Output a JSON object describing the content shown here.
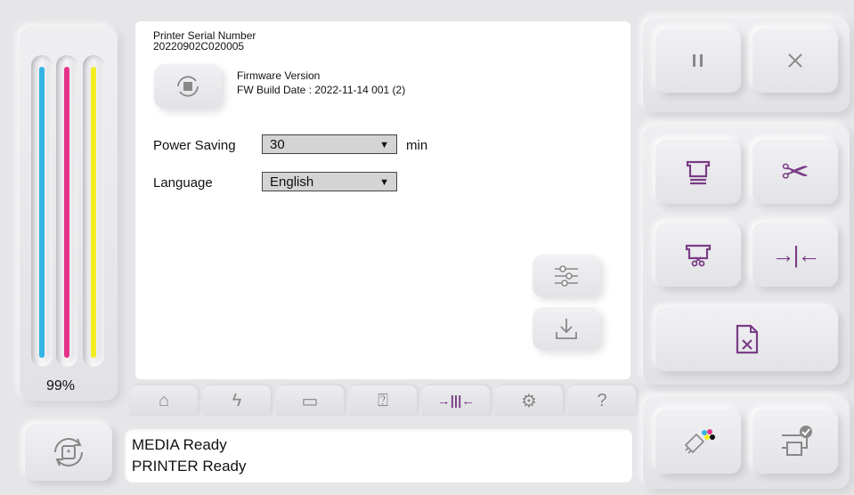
{
  "ink": {
    "percent_label": "99%",
    "levels": [
      {
        "name": "cyan",
        "color": "#33b3e6",
        "fraction": 0.99
      },
      {
        "name": "magenta",
        "color": "#e6338a",
        "fraction": 0.99
      },
      {
        "name": "yellow",
        "color": "#f2ee22",
        "fraction": 0.99
      }
    ]
  },
  "info": {
    "serial_label": "Printer Serial Number",
    "serial_value": "20220902C020005",
    "firmware_label": "Firmware Version",
    "firmware_build": "FW Build Date : 2022-11-14 001 (2)"
  },
  "settings": {
    "power_saving_label": "Power Saving",
    "power_saving_value": "30",
    "power_saving_unit": "min",
    "language_label": "Language",
    "language_value": "English"
  },
  "tabs": [
    {
      "icon": "home-icon",
      "glyph": "⌂"
    },
    {
      "icon": "lightning-icon",
      "glyph": "ϟ"
    },
    {
      "icon": "media-icon",
      "glyph": "▭"
    },
    {
      "icon": "media-roll-icon",
      "glyph": "⍰"
    },
    {
      "icon": "color-align-icon",
      "glyph": "→|||←"
    },
    {
      "icon": "gear-icon",
      "glyph": "⚙"
    },
    {
      "icon": "help-icon",
      "glyph": "?"
    }
  ],
  "status": {
    "line1": "MEDIA Ready",
    "line2": "PRINTER Ready"
  },
  "colors": {
    "accent_purple": "#7a3d86",
    "icon_gray": "#8a8a8a"
  }
}
